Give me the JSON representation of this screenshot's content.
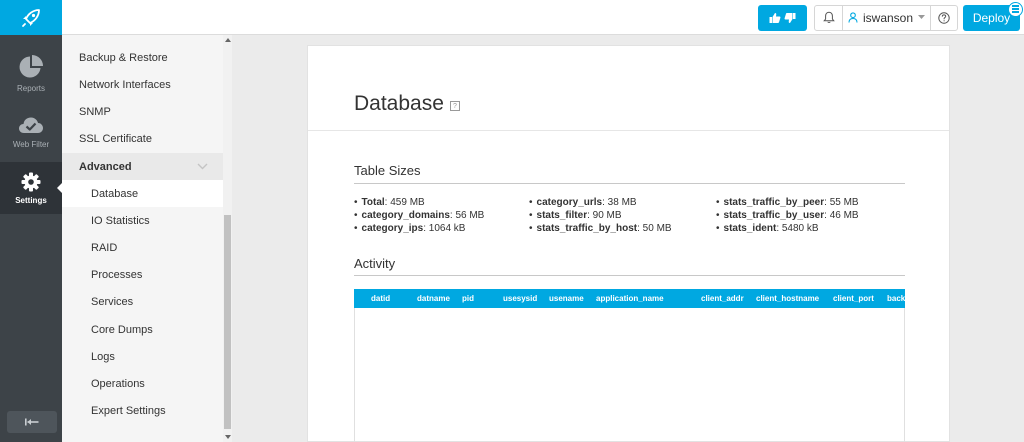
{
  "topbar": {
    "user": "iswanson",
    "deploy_label": "Deploy"
  },
  "leftnav": [
    {
      "label": "Reports"
    },
    {
      "label": "Web Filter"
    },
    {
      "label": "Settings"
    }
  ],
  "subnav": {
    "items_top": [
      "Backup & Restore",
      "Network Interfaces",
      "SNMP",
      "SSL Certificate"
    ],
    "group_label": "Advanced",
    "items_sub": [
      "Database",
      "IO Statistics",
      "RAID",
      "Processes",
      "Services",
      "Core Dumps",
      "Logs",
      "Operations",
      "Expert Settings"
    ]
  },
  "content": {
    "title": "Database",
    "help_glyph": "?",
    "table_sizes_title": "Table Sizes",
    "sizes": [
      [
        {
          "k": "Total",
          "v": "459 MB"
        },
        {
          "k": "category_domains",
          "v": "56 MB"
        },
        {
          "k": "category_ips",
          "v": "1064 kB"
        }
      ],
      [
        {
          "k": "category_urls",
          "v": "38 MB"
        },
        {
          "k": "stats_filter",
          "v": "90 MB"
        },
        {
          "k": "stats_traffic_by_host",
          "v": "50 MB"
        }
      ],
      [
        {
          "k": "stats_traffic_by_peer",
          "v": "55 MB"
        },
        {
          "k": "stats_traffic_by_user",
          "v": "46 MB"
        },
        {
          "k": "stats_ident",
          "v": "5480 kB"
        }
      ]
    ],
    "activity_title": "Activity",
    "activity_columns": [
      "datid",
      "datname",
      "pid",
      "usesysid",
      "usename",
      "application_name",
      "client_addr",
      "client_hostname",
      "client_port",
      "back"
    ]
  },
  "colors": {
    "accent": "#00a8e1",
    "nav_bg": "#3d4348"
  }
}
